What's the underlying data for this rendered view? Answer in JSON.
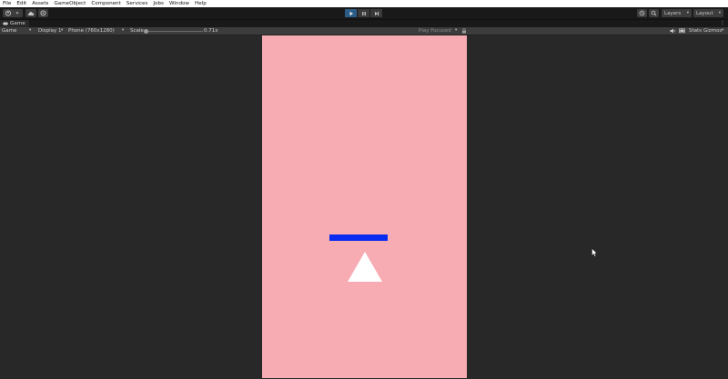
{
  "menu": [
    "File",
    "Edit",
    "Assets",
    "GameObject",
    "Component",
    "Services",
    "Jobs",
    "Window",
    "Help"
  ],
  "toolbar": {
    "layers_label": "Layers",
    "layout_label": "Layout"
  },
  "tabs": [
    {
      "label": "Game"
    }
  ],
  "game_bar": {
    "view_mode": "Game",
    "display": "Display 1",
    "resolution": "Phone (760x1280)",
    "scale_label": "Scale",
    "scale_value": "0.71x",
    "scale_fraction": 0.05,
    "play_mode": "Play Focused",
    "stats_label": "Stats",
    "gizmos_label": "Gizmos"
  },
  "scene": {
    "background_color": "#f7abb3",
    "paddle_color": "#0a2cf0",
    "triangle_color": "#ffffff"
  },
  "colors": {
    "editor_bg": "#282828",
    "play_active": "#2c5d87"
  }
}
